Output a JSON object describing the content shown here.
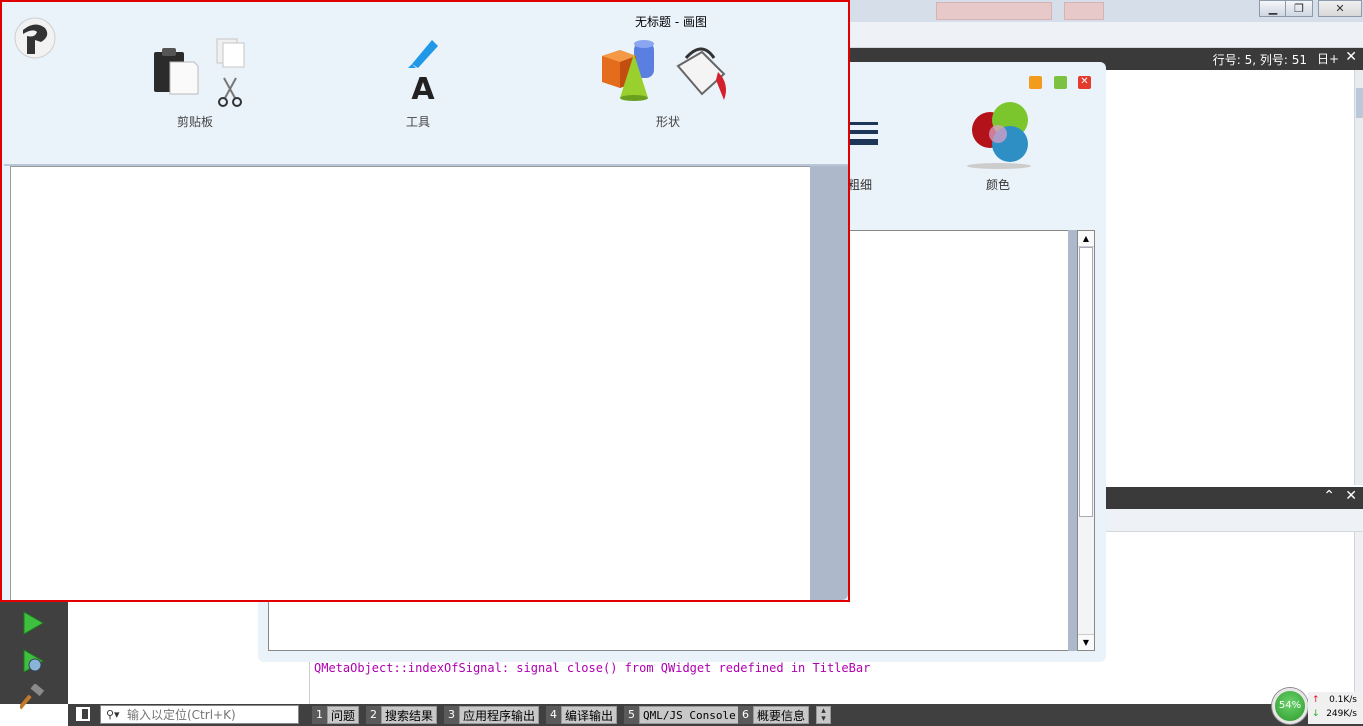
{
  "ide": {
    "editor_position": "行号: 5, 列号: 51",
    "editor_split_icon": "日+",
    "message": "QMetaObject::indexOfSignal: signal close() from QWidget redefined in TitleBar",
    "locator_placeholder": "输入以定位(Ctrl+K)",
    "output_tabs": [
      {
        "num": "1",
        "label": "问题"
      },
      {
        "num": "2",
        "label": "搜索结果"
      },
      {
        "num": "3",
        "label": "应用程序输出"
      },
      {
        "num": "4",
        "label": "编译输出"
      },
      {
        "num": "5",
        "label": "QML/JS Console"
      },
      {
        "num": "6",
        "label": "概要信息"
      }
    ],
    "network": {
      "percent": "54%",
      "up": "0.1K/s",
      "down": "249K/s"
    }
  },
  "bg_paint_window": {
    "stroke_label": "粗细",
    "color_label": "颜色"
  },
  "paint_window": {
    "title": "无标题 - 画图",
    "groups": {
      "clipboard": "剪贴板",
      "tools": "工具",
      "shape": "形状"
    }
  },
  "colors": {
    "highlight_border": "#e00000",
    "ribbon_bg": "#eaf2fa",
    "message_color": "#b000b0",
    "ide_dark": "#404040"
  }
}
